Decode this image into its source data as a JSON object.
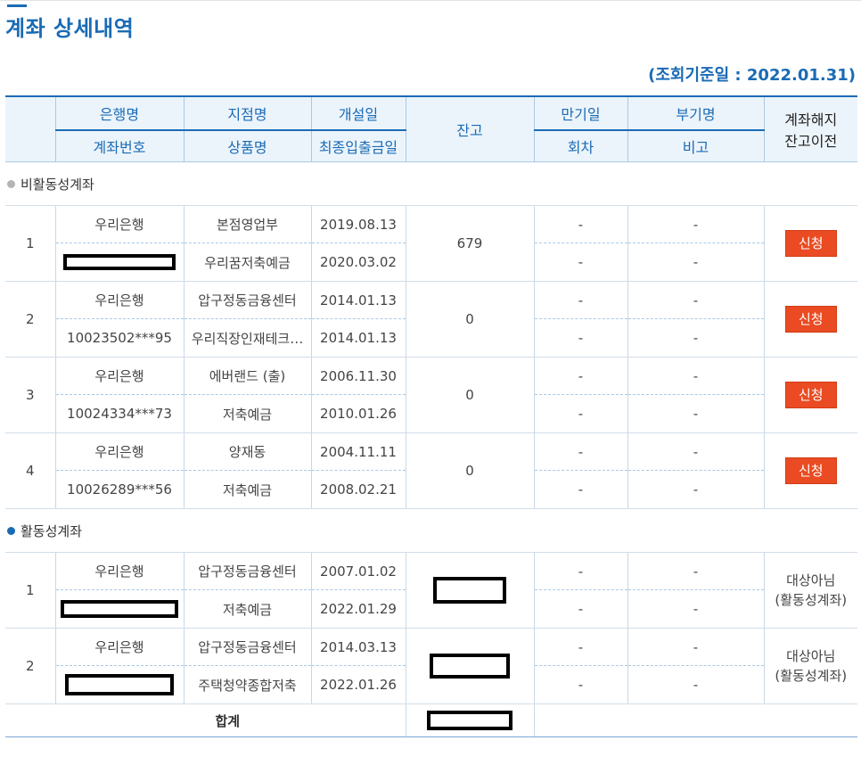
{
  "page": {
    "title": "계좌 상세내역",
    "reference_date": "(조회기준일 : 2022.01.31)"
  },
  "header": {
    "bank": "은행명",
    "account_no": "계좌번호",
    "branch": "지점명",
    "product": "상품명",
    "open_date": "개설일",
    "last_txn_date": "최종입출금일",
    "balance": "잔고",
    "maturity": "만기일",
    "installment": "회차",
    "sub_name": "부기명",
    "note": "비고",
    "close_line1": "계좌해지",
    "close_line2": "잔고이전"
  },
  "sections": {
    "inactive": "비활동성계좌",
    "active": "활동성계좌"
  },
  "inactive_rows": [
    {
      "no": "1",
      "bank": "우리은행",
      "account": "",
      "branch": "본점영업부",
      "product": "우리꿈저축예금",
      "open_date": "2019.08.13",
      "last_date": "2020.03.02",
      "balance": "679",
      "maturity": "-",
      "installment": "-",
      "sub_name": "-",
      "note": "-",
      "action": "신청"
    },
    {
      "no": "2",
      "bank": "우리은행",
      "account": "10023502***95",
      "branch": "압구정동금융센터",
      "product": "우리직장인재테크…",
      "open_date": "2014.01.13",
      "last_date": "2014.01.13",
      "balance": "0",
      "maturity": "-",
      "installment": "-",
      "sub_name": "-",
      "note": "-",
      "action": "신청"
    },
    {
      "no": "3",
      "bank": "우리은행",
      "account": "10024334***73",
      "branch": "에버랜드 (출)",
      "product": "저축예금",
      "open_date": "2006.11.30",
      "last_date": "2010.01.26",
      "balance": "0",
      "maturity": "-",
      "installment": "-",
      "sub_name": "-",
      "note": "-",
      "action": "신청"
    },
    {
      "no": "4",
      "bank": "우리은행",
      "account": "10026289***56",
      "branch": "양재동",
      "product": "저축예금",
      "open_date": "2004.11.11",
      "last_date": "2008.02.21",
      "balance": "0",
      "maturity": "-",
      "installment": "-",
      "sub_name": "-",
      "note": "-",
      "action": "신청"
    }
  ],
  "active_rows": [
    {
      "no": "1",
      "bank": "우리은행",
      "branch": "압구정동금융센터",
      "product": "저축예금",
      "open_date": "2007.01.02",
      "last_date": "2022.01.29",
      "maturity": "-",
      "installment": "-",
      "sub_name": "-",
      "note": "-",
      "status1": "대상아님",
      "status2": "(활동성계좌)"
    },
    {
      "no": "2",
      "bank": "우리은행",
      "branch": "압구정동금융센터",
      "product": "주택청약종합저축",
      "open_date": "2014.03.13",
      "last_date": "2022.01.26",
      "maturity": "-",
      "installment": "-",
      "sub_name": "-",
      "note": "-",
      "status1": "대상아님",
      "status2": "(활동성계좌)"
    }
  ],
  "total": {
    "label": "합계"
  }
}
